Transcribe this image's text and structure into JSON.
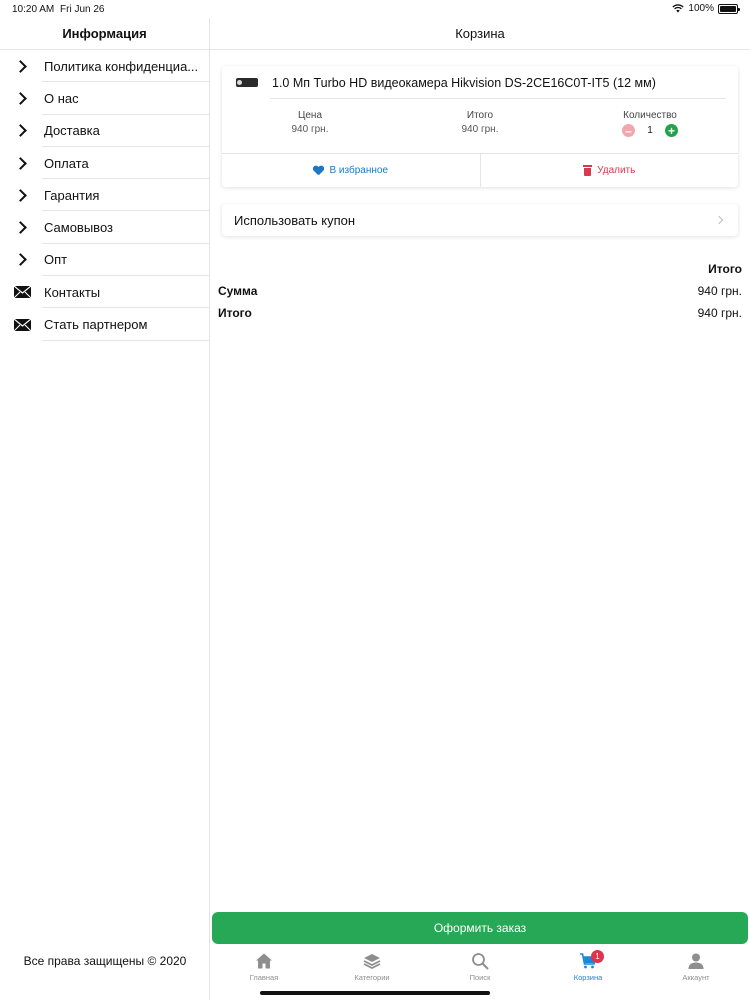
{
  "status_bar": {
    "time": "10:20 AM",
    "date": "Fri Jun 26",
    "battery": "100%"
  },
  "sidebar": {
    "title": "Информация",
    "items": [
      {
        "label": "Политика конфиденциа...",
        "icon": "chevron-right-icon"
      },
      {
        "label": "О нас",
        "icon": "chevron-right-icon"
      },
      {
        "label": "Доставка",
        "icon": "chevron-right-icon"
      },
      {
        "label": "Оплата",
        "icon": "chevron-right-icon"
      },
      {
        "label": "Гарантия",
        "icon": "chevron-right-icon"
      },
      {
        "label": "Самовывоз",
        "icon": "chevron-right-icon"
      },
      {
        "label": "Опт",
        "icon": "chevron-right-icon"
      },
      {
        "label": "Контакты",
        "icon": "envelope-icon"
      },
      {
        "label": "Стать партнером",
        "icon": "envelope-icon"
      }
    ],
    "copyright": "Все права защищены © 2020"
  },
  "main": {
    "title": "Корзина",
    "product": {
      "title": "1.0 Мп Turbo HD видеокамера Hikvision DS-2CE16C0T-IT5 (12 мм)",
      "price_label": "Цена",
      "price": "940 грн.",
      "total_label": "Итого",
      "total": "940 грн.",
      "qty_label": "Количество",
      "qty": "1",
      "fav_label": "В избранное",
      "delete_label": "Удалить"
    },
    "coupon_label": "Использовать купон",
    "totals": {
      "header": "Итого",
      "rows": [
        {
          "label": "Сумма",
          "value": "940 грн."
        },
        {
          "label": "Итого",
          "value": "940 грн."
        }
      ]
    },
    "checkout_label": "Оформить заказ"
  },
  "tabbar": {
    "tabs": [
      {
        "label": "Главная",
        "icon": "home-icon"
      },
      {
        "label": "Категории",
        "icon": "layers-icon"
      },
      {
        "label": "Поиск",
        "icon": "search-icon"
      },
      {
        "label": "Корзина",
        "icon": "cart-icon",
        "badge": "1"
      },
      {
        "label": "Аккаунт",
        "icon": "user-icon"
      }
    ]
  },
  "colors": {
    "accent_blue": "#1c86d6",
    "checkout_green": "#27a857",
    "delete_red": "#d9394c",
    "badge_red": "#e0334c"
  }
}
